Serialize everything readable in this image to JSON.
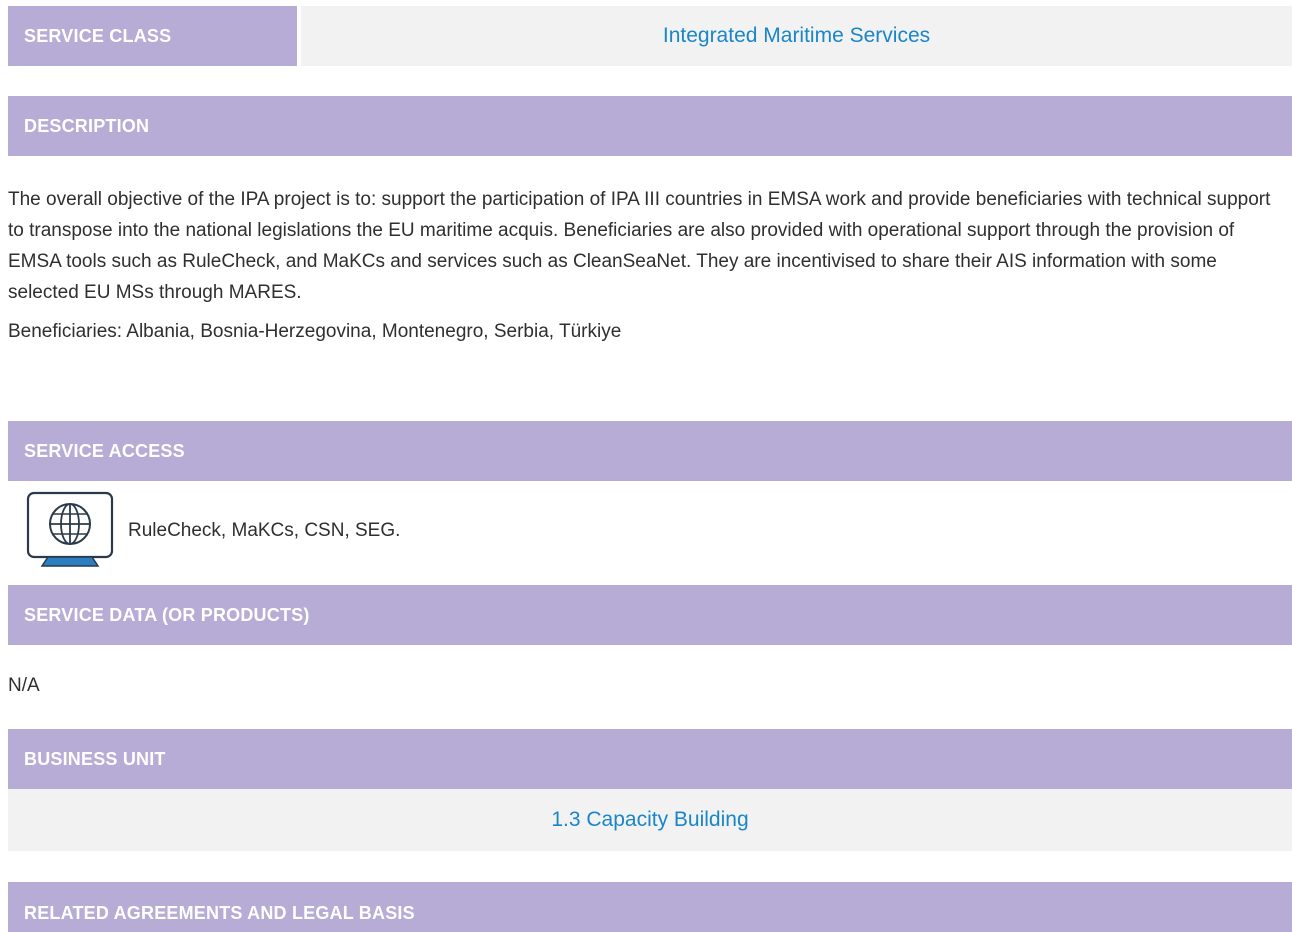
{
  "service_class": {
    "label": "SERVICE CLASS",
    "value": "Integrated Maritime Services"
  },
  "description": {
    "label": "DESCRIPTION",
    "paragraph": "The overall objective of the IPA project is to: support the participation of IPA III countries in EMSA work and provide beneficiaries with technical support to transpose into the national legislations the EU maritime acquis. Beneficiaries are also provided with operational support through the provision of EMSA tools such as RuleCheck, and MaKCs and services such as CleanSeaNet. They are incentivised to share their AIS information with some selected EU MSs through MARES.",
    "beneficiaries": "Beneficiaries: Albania, Bosnia-Herzegovina, Montenegro, Serbia, Türkiye"
  },
  "service_access": {
    "label": "SERVICE ACCESS",
    "icon": "globe-monitor-icon",
    "value": "RuleCheck, MaKCs, CSN, SEG."
  },
  "service_data": {
    "label": "SERVICE DATA (OR PRODUCTS)",
    "value": "N/A"
  },
  "business_unit": {
    "label": "BUSINESS UNIT",
    "value": "1.3 Capacity Building"
  },
  "related_agreements": {
    "label": "RELATED AGREEMENTS AND LEGAL BASIS"
  },
  "colors": {
    "header_bar": "#b6acd6",
    "value_bar": "#f2f2f2",
    "link": "#1a86c8"
  }
}
